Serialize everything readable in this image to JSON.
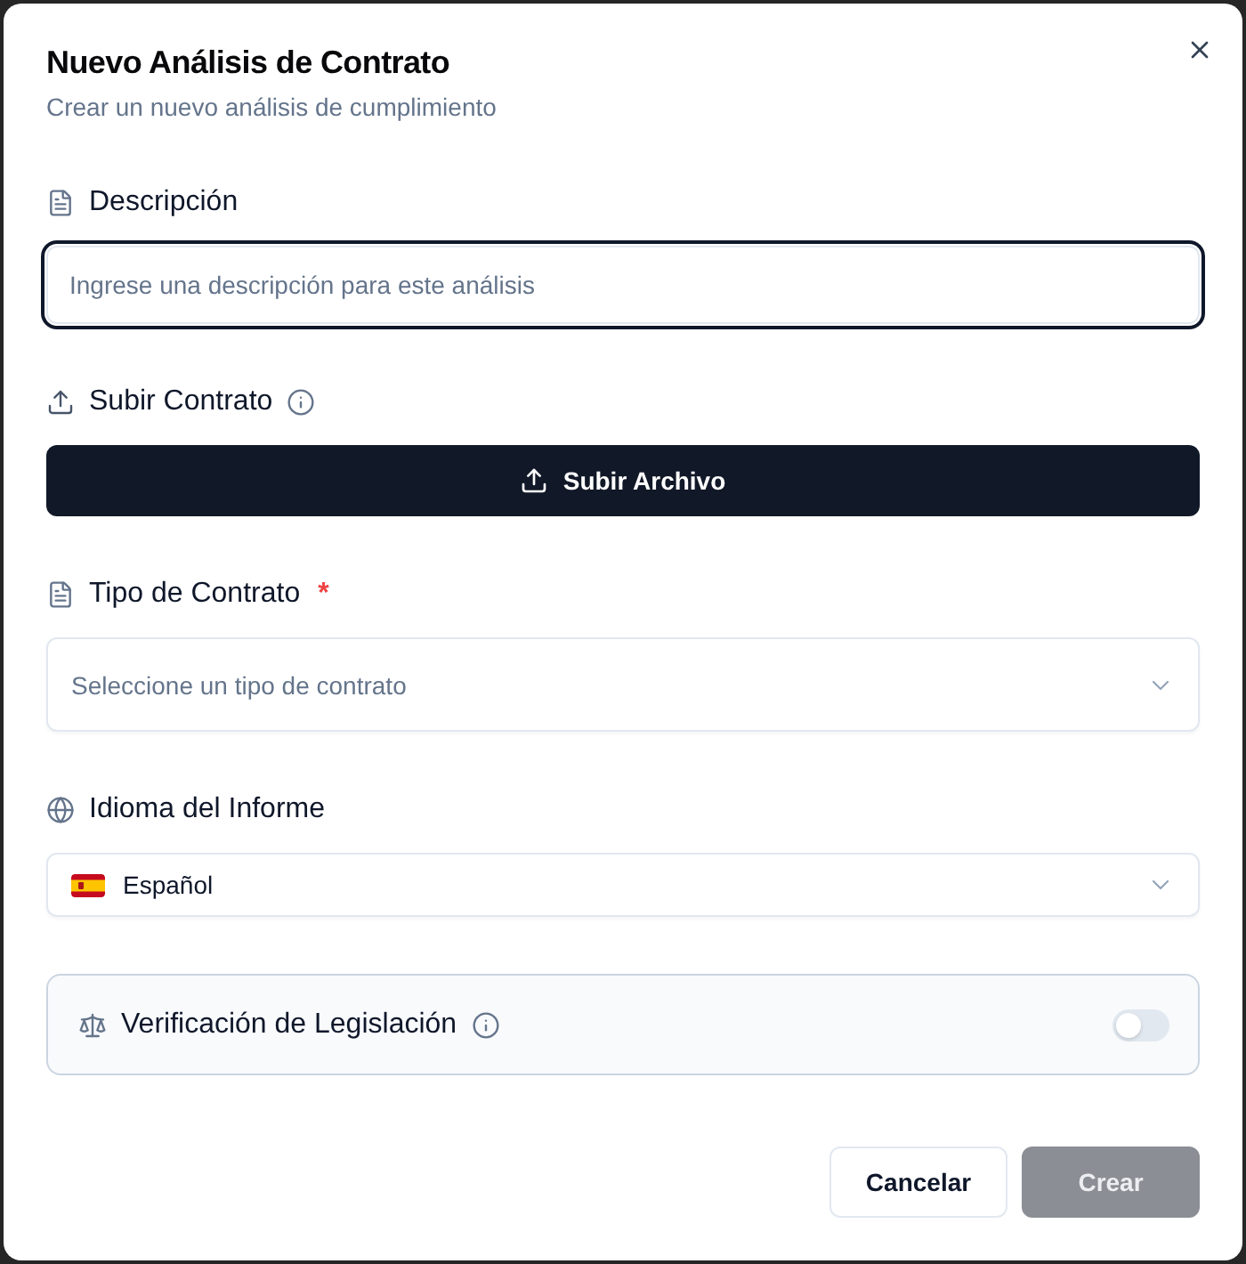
{
  "dialog": {
    "title": "Nuevo Análisis de Contrato",
    "subtitle": "Crear un nuevo análisis de cumplimiento"
  },
  "fields": [
    {
      "kind": "text",
      "label": "Descripción",
      "placeholder": "Ingrese una descripción para este análisis",
      "focused": true
    },
    {
      "kind": "upload",
      "label": "Subir Contrato",
      "info": true,
      "button": "Subir Archivo"
    },
    {
      "kind": "select",
      "label": "Tipo de Contrato",
      "required_mark": "*",
      "placeholder": "Seleccione un tipo de contrato"
    },
    {
      "kind": "language",
      "label": "Idioma del Informe",
      "value": "Español"
    }
  ],
  "legislation_check": {
    "label": "Verificación de Legislación",
    "info": true,
    "on": false
  },
  "buttons": [
    {
      "label": "Cancelar",
      "kind": "secondary",
      "disabled": false
    },
    {
      "label": "Crear",
      "kind": "primary",
      "disabled": true
    }
  ]
}
